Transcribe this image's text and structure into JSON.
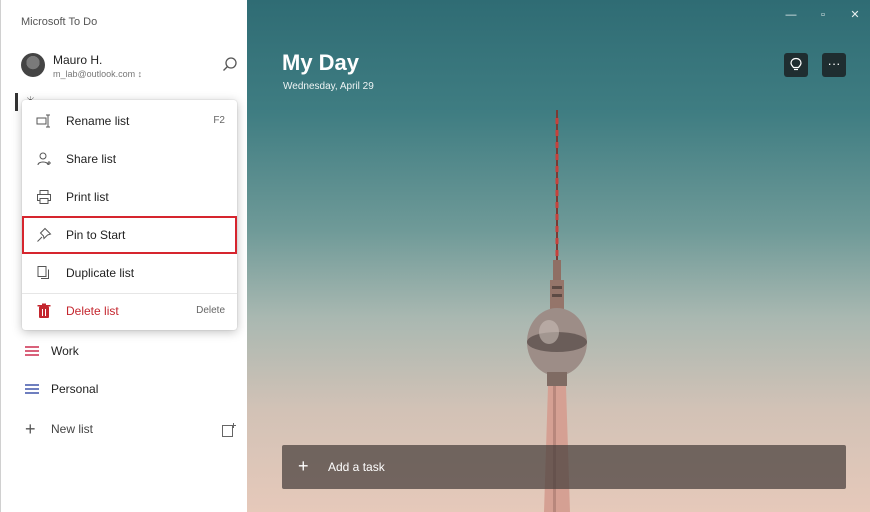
{
  "app": {
    "title": "Microsoft To Do"
  },
  "user": {
    "name": "Mauro H.",
    "email": "m_lab@outlook.com ↕"
  },
  "context_menu": {
    "items": [
      {
        "label": "Rename list",
        "shortcut": "F2",
        "icon": "rename-icon"
      },
      {
        "label": "Share list",
        "shortcut": "",
        "icon": "share-person-icon"
      },
      {
        "label": "Print list",
        "shortcut": "",
        "icon": "printer-icon"
      },
      {
        "label": "Pin to Start",
        "shortcut": "",
        "icon": "pin-icon",
        "highlighted": true
      },
      {
        "label": "Duplicate list",
        "shortcut": "",
        "icon": "duplicate-icon"
      },
      {
        "label": "Delete list",
        "shortcut": "Delete",
        "icon": "trash-icon",
        "danger": true
      }
    ]
  },
  "sidebar": {
    "lists": [
      {
        "label": "Work",
        "color": "#d9617a"
      },
      {
        "label": "Personal",
        "color": "#6f7fbf"
      }
    ],
    "new_list_label": "New list"
  },
  "main": {
    "title": "My Day",
    "date": "Wednesday, April 29",
    "add_task_label": "Add a task"
  },
  "colors": {
    "highlight_border": "#d6252e",
    "danger_text": "#c4262e",
    "add_task_bg": "#463e3c"
  }
}
